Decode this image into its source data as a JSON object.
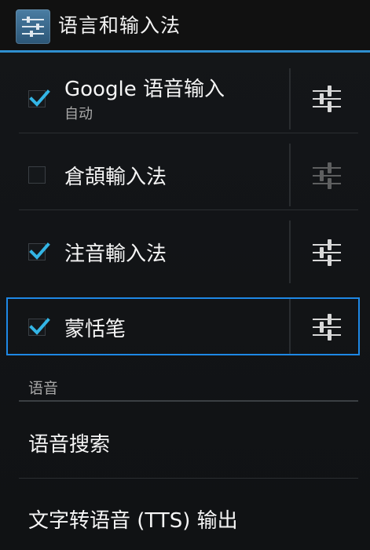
{
  "actionbar": {
    "title": "语言和输入法",
    "icon": "settings-sliders-icon"
  },
  "input_methods": [
    {
      "label": "Google 语音输入",
      "subtitle": "自动",
      "checked": true,
      "settings_enabled": true
    },
    {
      "label": "倉頡輸入法",
      "subtitle": "",
      "checked": false,
      "settings_enabled": false
    },
    {
      "label": "注音輸入法",
      "subtitle": "",
      "checked": true,
      "settings_enabled": true
    },
    {
      "label": "蒙恬笔",
      "subtitle": "",
      "checked": true,
      "settings_enabled": true,
      "focused": true
    }
  ],
  "speech_section": {
    "header": "语音",
    "items": [
      {
        "label": "语音搜索"
      },
      {
        "label": "文字转语音 (TTS) 输出"
      }
    ]
  },
  "colors": {
    "accent": "#2f8fcf",
    "focus_border": "#1e88e5",
    "check": "#33b5e5"
  }
}
